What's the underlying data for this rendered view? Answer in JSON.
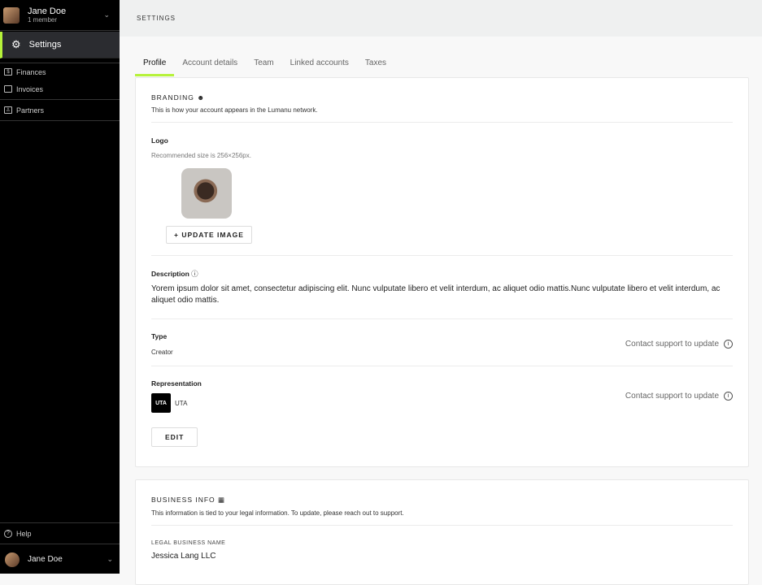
{
  "sidebar": {
    "account_name": "Jane Doe",
    "account_sub": "1 member",
    "active": "Settings",
    "items": [
      {
        "label": "Finances",
        "icon": "file-dollar-icon"
      },
      {
        "label": "Invoices",
        "icon": "invoice-icon"
      },
      {
        "label": "Partners",
        "icon": "contact-icon"
      }
    ],
    "help": "Help",
    "user": "Jane Doe"
  },
  "header": {
    "title": "SETTINGS"
  },
  "tabs": [
    "Profile",
    "Account details",
    "Team",
    "Linked accounts",
    "Taxes"
  ],
  "branding": {
    "title": "BRANDING",
    "subtitle": "This is how your account appears in the Lumanu network.",
    "logo_label": "Logo",
    "logo_hint": "Recommended size is 256×256px.",
    "update_image": "+ UPDATE IMAGE",
    "description_label": "Description",
    "description": "Yorem ipsum dolor sit amet, consectetur adipiscing elit. Nunc vulputate libero et velit interdum, ac aliquet odio mattis.Nunc vulputate libero et velit interdum, ac aliquet odio mattis.",
    "type_label": "Type",
    "type_value": "Creator",
    "support": "Contact support to update",
    "representation_label": "Representation",
    "rep_badge": "UTA",
    "rep_value": "UTA",
    "edit": "EDIT"
  },
  "business": {
    "title": "BUSINESS INFO",
    "subtitle": "This information is tied to your legal information. To update, please reach out to support.",
    "legal_label": "LEGAL BUSINESS NAME",
    "legal_value": "Jessica Lang LLC"
  },
  "colors": {
    "accent": "#b6f23a",
    "sidebar": "#000000"
  }
}
